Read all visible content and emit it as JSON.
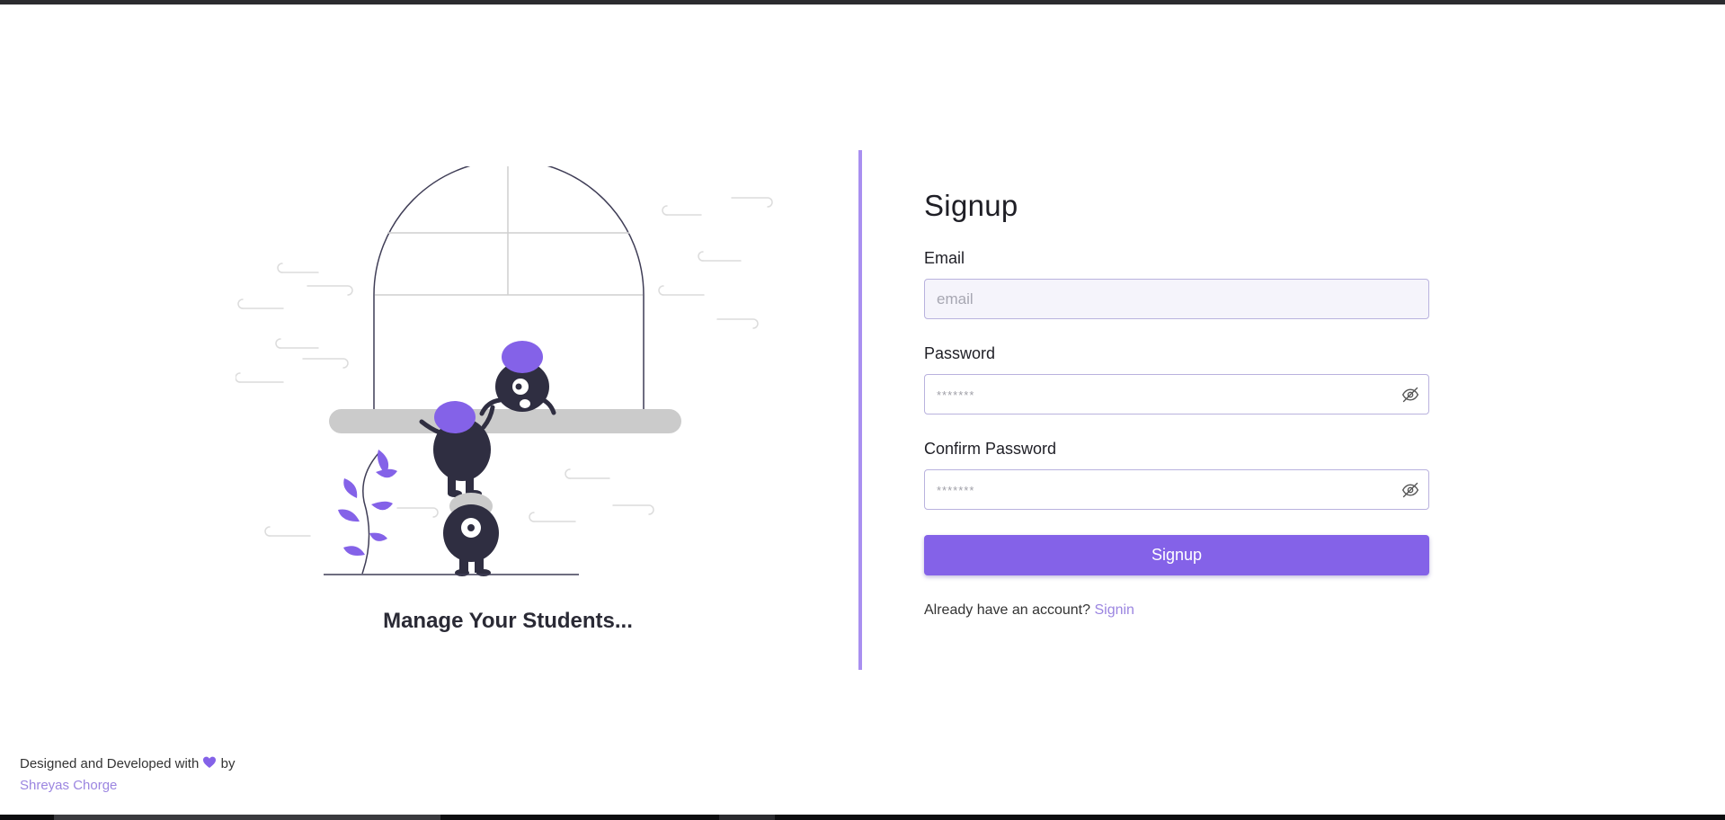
{
  "illustration": {
    "caption": "Manage Your Students..."
  },
  "form": {
    "title": "Signup",
    "email_label": "Email",
    "email_placeholder": "email",
    "password_label": "Password",
    "password_placeholder": "*******",
    "confirm_label": "Confirm Password",
    "confirm_placeholder": "*******",
    "submit_label": "Signup",
    "account_prompt": "Already have an account?",
    "signin_link": "Signin"
  },
  "footer": {
    "text_before": "Designed and Developed with",
    "text_after": "by",
    "author": "Shreyas Chorge"
  },
  "colors": {
    "accent": "#8462e8",
    "divider": "#a98ff0",
    "link": "#9b85e0",
    "dark": "#2f2e41"
  },
  "icons": [
    "eye-off-icon",
    "heart-icon"
  ]
}
